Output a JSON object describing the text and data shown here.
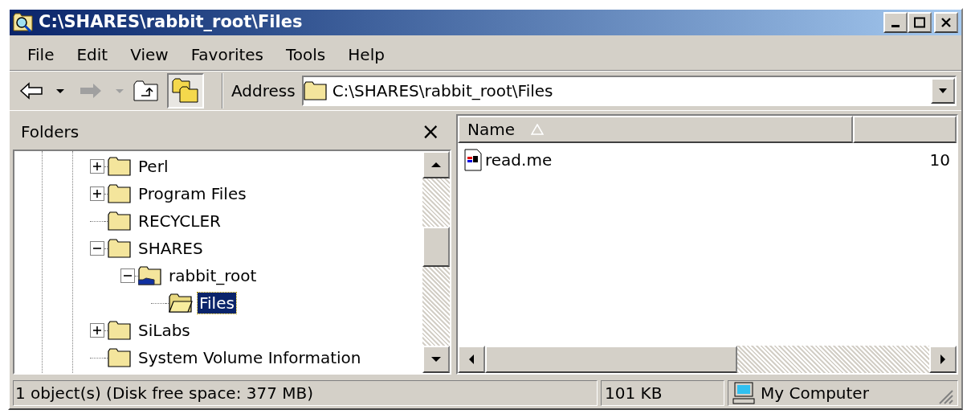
{
  "window": {
    "title": "C:\\SHARES\\rabbit_root\\Files"
  },
  "menu": [
    {
      "label": "File"
    },
    {
      "label": "Edit"
    },
    {
      "label": "View"
    },
    {
      "label": "Favorites"
    },
    {
      "label": "Tools"
    },
    {
      "label": "Help"
    }
  ],
  "toolbar": {
    "folders_selected": true,
    "address_label": "Address",
    "address": "C:\\SHARES\\rabbit_root\\Files"
  },
  "folders_pane": {
    "title": "Folders",
    "close": "×",
    "tree": [
      {
        "label": "Perl",
        "has_children": true,
        "expanded": false,
        "selected": false
      },
      {
        "label": "Program Files",
        "has_children": true,
        "expanded": false,
        "selected": false
      },
      {
        "label": "RECYCLER",
        "has_children": false,
        "selected": false
      },
      {
        "label": "SHARES",
        "has_children": true,
        "expanded": true,
        "selected": false,
        "children": [
          {
            "label": "rabbit_root",
            "kind": "shared",
            "has_children": true,
            "expanded": true,
            "selected": false,
            "children": [
              {
                "label": "Files",
                "kind": "open",
                "has_children": false,
                "selected": true
              }
            ]
          }
        ]
      },
      {
        "label": "SiLabs",
        "has_children": true,
        "expanded": false,
        "selected": false
      },
      {
        "label": "System Volume Information",
        "has_children": false,
        "selected": false
      }
    ]
  },
  "file_list": {
    "columns": [
      {
        "label": "Name",
        "sorted": true
      }
    ],
    "rows": [
      {
        "name": "read.me",
        "column_2": "10"
      }
    ]
  },
  "status_bar": {
    "summary": "1 object(s) (Disk free space: 377 MB)",
    "size": "101 KB",
    "zone": "My Computer"
  }
}
